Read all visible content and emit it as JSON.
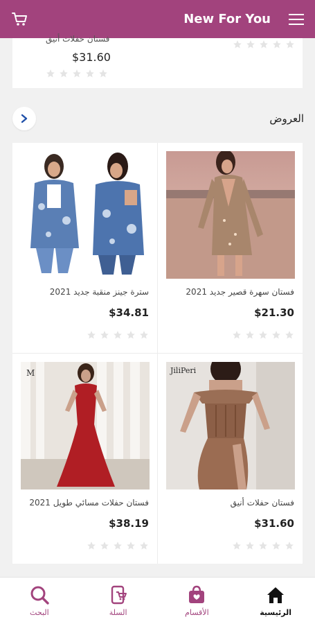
{
  "header": {
    "title": "New For You",
    "cart_icon": "cart-icon",
    "menu_icon": "hamburger-menu-icon"
  },
  "previous_row": {
    "title_partial": "فستان حفلات أنيق",
    "price": "$31.60"
  },
  "section": {
    "title": "العروض",
    "arrow_icon": "chevron-right-icon"
  },
  "products": [
    {
      "name": "سترة جينز منقبة جديد 2021",
      "price": "$34.81",
      "rating": 0,
      "image": "denim-jacket-photo"
    },
    {
      "name": "فستان سهرة قصير جديد 2021",
      "price": "$21.30",
      "rating": 0,
      "image": "sequin-dress-photo"
    },
    {
      "name": "فستان حفلات مسائي طويل 2021",
      "price": "$38.19",
      "rating": 0,
      "image": "red-satin-gown-photo"
    },
    {
      "name": "فستان حفلات أنيق",
      "price": "$31.60",
      "rating": 0,
      "image": "brown-corset-dress-photo"
    }
  ],
  "bottom_nav": [
    {
      "label": "الرئيسية",
      "icon": "home-icon",
      "active": true
    },
    {
      "label": "الأقسام",
      "icon": "bag-icon",
      "active": false
    },
    {
      "label": "السلة",
      "icon": "cart-phone-icon",
      "active": false
    },
    {
      "label": "البحث",
      "icon": "search-icon",
      "active": false
    }
  ],
  "colors": {
    "brand": "#a2437d",
    "star_empty": "#e4e4e4",
    "background": "#f1f1f1"
  }
}
